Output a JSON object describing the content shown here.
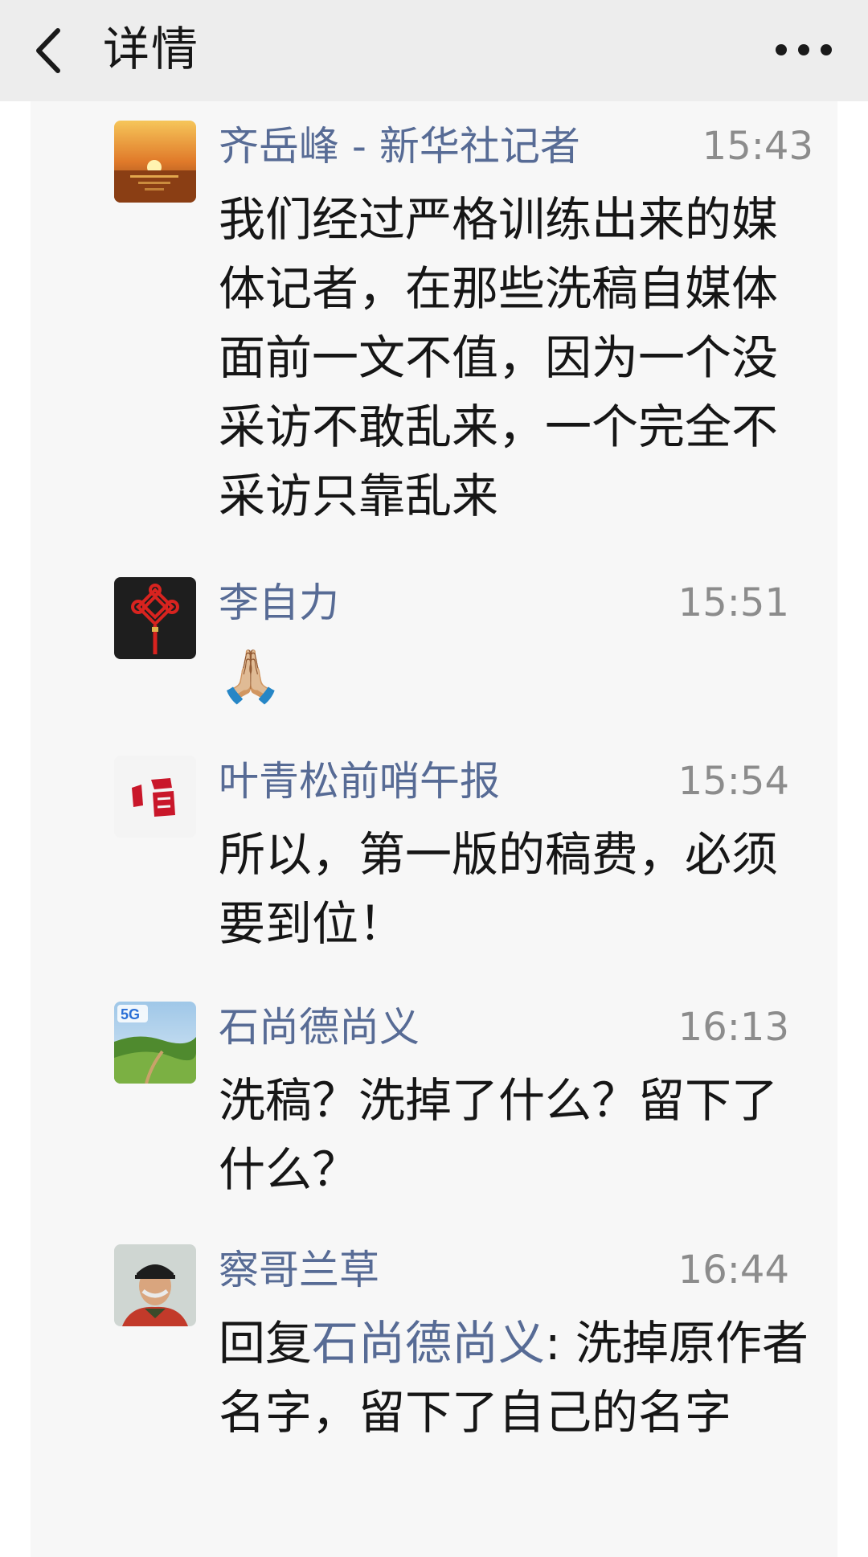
{
  "header": {
    "title": "详情"
  },
  "comments": [
    {
      "name": "齐岳峰 - 新华社记者",
      "time": "15:43",
      "text": "我们经过严格训练出来的媒体记者，在那些洗稿自媒体面前一文不值，因为一个没采访不敢乱来，一个完全不采访只靠乱来"
    },
    {
      "name": "李自力",
      "time": "15:51",
      "text": "🙏🏼"
    },
    {
      "name": "叶青松前哨午报",
      "time": "15:54",
      "text": "所以，第一版的稿费，必须要到位！"
    },
    {
      "name": "石尚德尚义",
      "time": "16:13",
      "text": "洗稿？洗掉了什么？留下了什么？"
    },
    {
      "name": "察哥兰草",
      "time": "16:44",
      "reply_prefix": "回复",
      "reply_to": "石尚德尚义",
      "text": ": 洗掉原作者名字，留下了自己的名字"
    }
  ],
  "avatars": {
    "a1": "sunset-avatar",
    "a2": "chinese-knot-avatar",
    "a3": "calligraphy-avatar",
    "a4": "5g-landscape-avatar",
    "a5": "man-with-cap-avatar"
  },
  "colors": {
    "link": "#576b95",
    "text": "#161616",
    "time": "#8c8c8c",
    "header_bg": "#ededed",
    "panel_bg": "#f7f7f7"
  }
}
